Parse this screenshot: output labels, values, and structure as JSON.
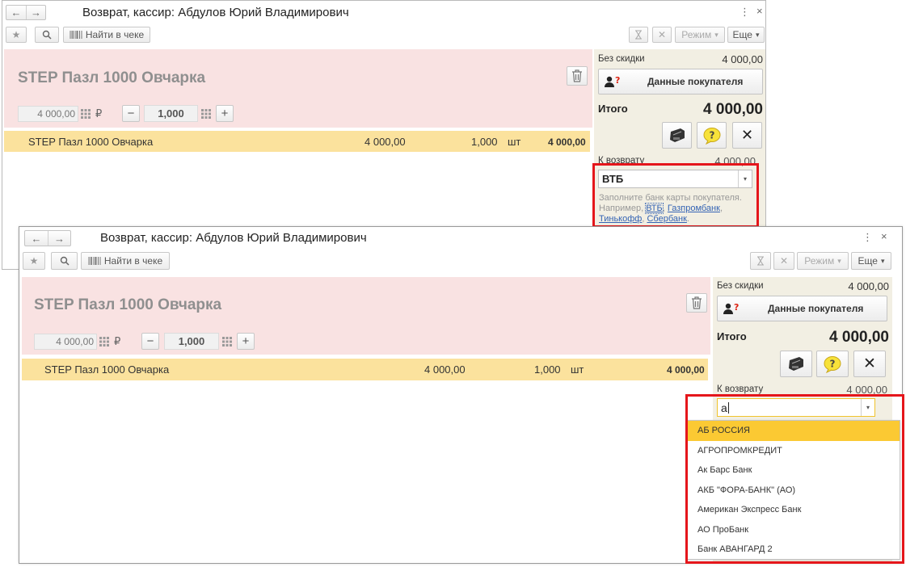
{
  "window": {
    "title": "Возврат, кассир: Абдулов Юрий Владимирович",
    "nav_back": "←",
    "nav_forward": "→",
    "menu_glyph": "⋮",
    "close_glyph": "×"
  },
  "toolbar": {
    "star_glyph": "★",
    "search_icon": "search-icon",
    "find_in_receipt": "Найти в чеке",
    "mode_label": "Режим",
    "more_label": "Еще",
    "dropdown_glyph": "▾"
  },
  "product": {
    "title": "STEP Пазл 1000 Овчарка",
    "price": "4 000,00",
    "currency": "₽",
    "quantity": "1,000",
    "minus": "−",
    "plus": "+"
  },
  "receipt_row": {
    "name": "STEP Пазл 1000 Овчарка",
    "price": "4 000,00",
    "qty": "1,000",
    "unit": "шт",
    "sum": "4 000,00"
  },
  "panel": {
    "no_discount_label": "Без скидки",
    "no_discount_value": "4 000,00",
    "customer_button": "Данные покупателя",
    "total_label": "Итого",
    "total_value": "4 000,00",
    "refund_label": "К возврату",
    "refund_value": "4 000,00"
  },
  "bank_field_1": {
    "value": "ВТБ",
    "hint_prefix": "Заполните банк карты покупателя.",
    "hint_example": "Например,",
    "links": [
      "ВТБ",
      "Газпромбанк",
      "Тинькофф",
      "Сбербанк"
    ],
    "sep": ",",
    "end": "."
  },
  "bank_field_2": {
    "value": "а",
    "options": [
      "АБ РОССИЯ",
      "АГРОПРОМКРЕДИТ",
      "Ак Барс Банк",
      "АКБ \"ФОРА-БАНК\" (АО)",
      "Американ Экспресс Банк",
      "АО ПроБанк",
      "Банк АВАНГАРД 2"
    ],
    "selected_index": 0
  },
  "colors": {
    "highlight_red": "#e5161b",
    "row_yellow": "#fbe29d",
    "selected_yellow": "#fbc933",
    "pink": "#f9e2e2",
    "panel_bg": "#f2efe3",
    "link_blue": "#3564b4"
  }
}
